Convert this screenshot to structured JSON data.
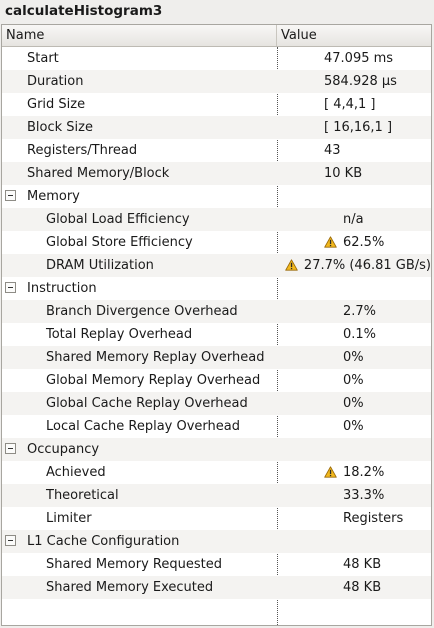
{
  "window": {
    "title": "calculateHistogram3"
  },
  "header": {
    "name_col": "Name",
    "value_col": "Value"
  },
  "rows": [
    {
      "label": "Start",
      "value": "47.095 ms",
      "level": 0,
      "group": false,
      "warn": false
    },
    {
      "label": "Duration",
      "value": "584.928 μs",
      "level": 0,
      "group": false,
      "warn": false
    },
    {
      "label": "Grid Size",
      "value": "[ 4,4,1 ]",
      "level": 0,
      "group": false,
      "warn": false
    },
    {
      "label": "Block Size",
      "value": "[ 16,16,1 ]",
      "level": 0,
      "group": false,
      "warn": false
    },
    {
      "label": "Registers/Thread",
      "value": "43",
      "level": 0,
      "group": false,
      "warn": false
    },
    {
      "label": "Shared  Memory/Block",
      "value": "10 KB",
      "level": 0,
      "group": false,
      "warn": false
    },
    {
      "label": "Memory",
      "value": "",
      "level": 0,
      "group": true,
      "warn": false
    },
    {
      "label": "Global Load Efficiency",
      "value": "n/a",
      "level": 1,
      "group": false,
      "warn": false
    },
    {
      "label": "Global Store Efficiency",
      "value": "62.5%",
      "level": 1,
      "group": false,
      "warn": true
    },
    {
      "label": "DRAM Utilization",
      "value": "27.7% (46.81 GB/s)",
      "level": 1,
      "group": false,
      "warn": true
    },
    {
      "label": "Instruction",
      "value": "",
      "level": 0,
      "group": true,
      "warn": false
    },
    {
      "label": "Branch Divergence Overhead",
      "value": "2.7%",
      "level": 1,
      "group": false,
      "warn": false
    },
    {
      "label": "Total Replay Overhead",
      "value": "0.1%",
      "level": 1,
      "group": false,
      "warn": false
    },
    {
      "label": "Shared Memory Replay Overhead",
      "value": "0%",
      "level": 1,
      "group": false,
      "warn": false
    },
    {
      "label": "Global Memory Replay Overhead",
      "value": "0%",
      "level": 1,
      "group": false,
      "warn": false
    },
    {
      "label": "Global Cache Replay Overhead",
      "value": "0%",
      "level": 1,
      "group": false,
      "warn": false
    },
    {
      "label": "Local Cache Replay Overhead",
      "value": "0%",
      "level": 1,
      "group": false,
      "warn": false
    },
    {
      "label": "Occupancy",
      "value": "",
      "level": 0,
      "group": true,
      "warn": false
    },
    {
      "label": "Achieved",
      "value": "18.2%",
      "level": 1,
      "group": false,
      "warn": true
    },
    {
      "label": "Theoretical",
      "value": "33.3%",
      "level": 1,
      "group": false,
      "warn": false
    },
    {
      "label": "Limiter",
      "value": "Registers",
      "level": 1,
      "group": false,
      "warn": false
    },
    {
      "label": "L1 Cache Configuration",
      "value": "",
      "level": 0,
      "group": true,
      "warn": false
    },
    {
      "label": "Shared Memory Requested",
      "value": "48 KB",
      "level": 1,
      "group": false,
      "warn": false
    },
    {
      "label": "Shared Memory Executed",
      "value": "48 KB",
      "level": 1,
      "group": false,
      "warn": false
    }
  ],
  "icons": {
    "group_toggle": "collapse-minus-icon",
    "warning": "warning-triangle-icon"
  },
  "colors": {
    "warning_fill": "#f2b81d",
    "row_alt": "#f4f3f1"
  }
}
